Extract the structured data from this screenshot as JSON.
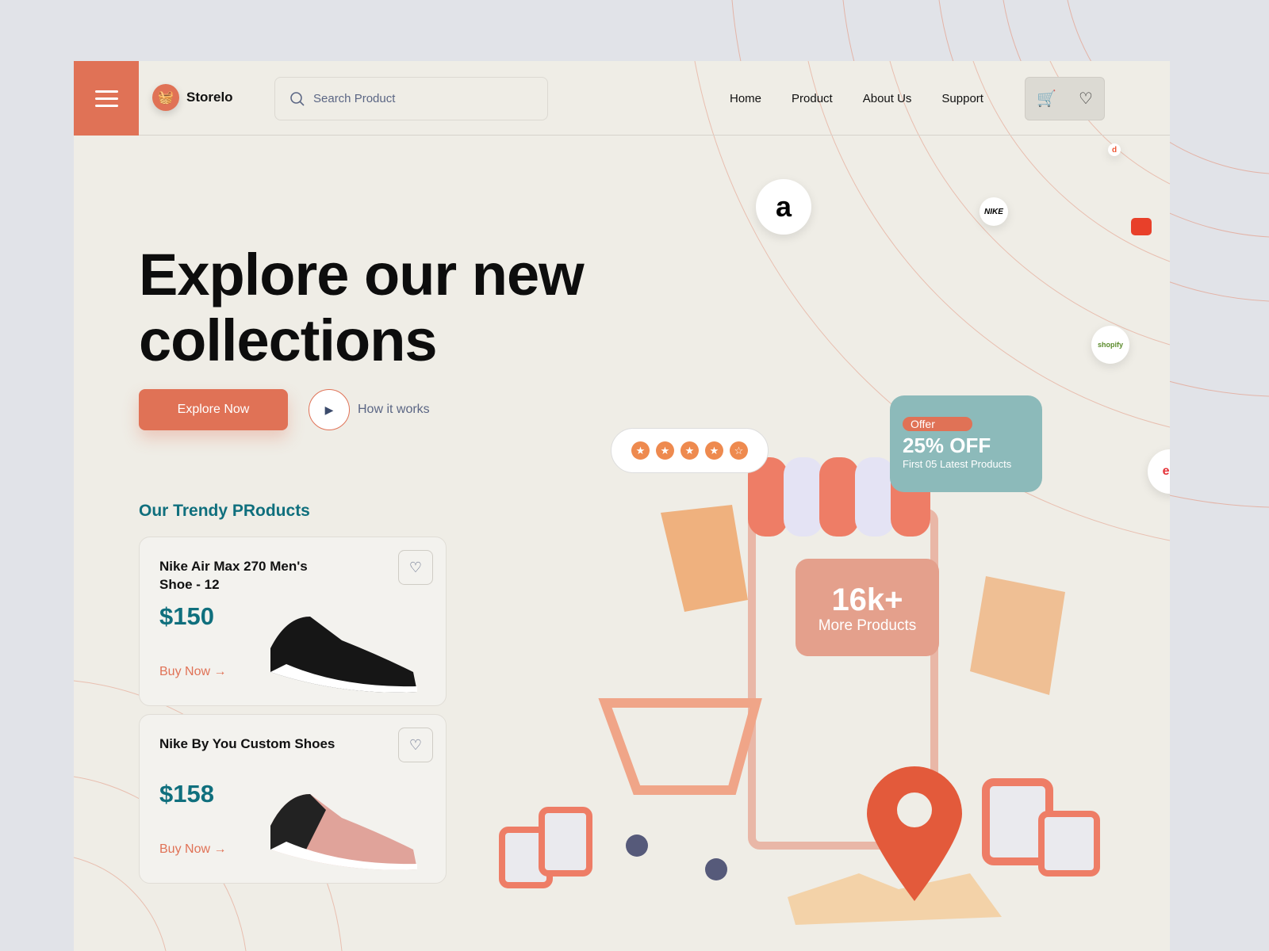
{
  "header": {
    "brand": "Storelo",
    "search_placeholder": "Search Product",
    "nav": [
      "Home",
      "Product",
      "About Us",
      "Support"
    ]
  },
  "hero": {
    "title_line1": "Explore our new",
    "title_line2": "collections",
    "explore_label": "Explore Now",
    "how_label": "How it works"
  },
  "trendy": {
    "heading": "Our Trendy PRoducts",
    "products": [
      {
        "name": "Nike Air Max 270 Men's Shoe - 12",
        "price": "$150",
        "buy": "Buy Now →"
      },
      {
        "name": "Nike By You Custom Shoes",
        "price": "$158",
        "buy": "Buy Now →"
      }
    ]
  },
  "illustration": {
    "rating_stars": 5,
    "offer_tag": "Offer",
    "offer_value": "25% OFF",
    "offer_sub": "First 05 Latest Products",
    "count": "16k+",
    "count_label": "More Products"
  },
  "brands": [
    "a",
    "NIKE",
    "shopify",
    "eb",
    "d",
    "a"
  ],
  "colors": {
    "accent": "#e07256",
    "teal": "#0f6f7d",
    "offer": "#8cbaba"
  }
}
